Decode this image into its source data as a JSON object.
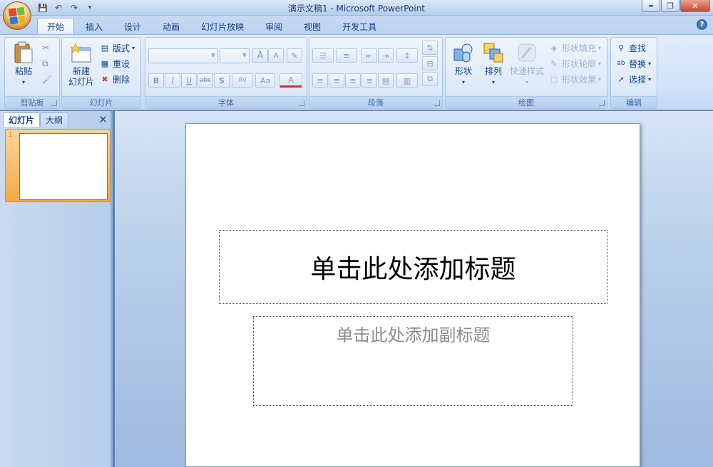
{
  "window": {
    "title": "演示文稿1 - Microsoft PowerPoint",
    "controls": {
      "minimize": "▬",
      "restore": "❐",
      "close": "✕"
    }
  },
  "quick_access": {
    "save": "💾",
    "undo": "↶",
    "redo": "↷",
    "customize": "▾"
  },
  "tabs": [
    {
      "label": "开始",
      "active": true
    },
    {
      "label": "插入"
    },
    {
      "label": "设计"
    },
    {
      "label": "动画"
    },
    {
      "label": "幻灯片放映"
    },
    {
      "label": "审阅"
    },
    {
      "label": "视图"
    },
    {
      "label": "开发工具"
    }
  ],
  "help": "?",
  "ribbon": {
    "clipboard": {
      "label": "剪贴板",
      "paste": "粘贴",
      "cut": "✂",
      "copy": "⧉",
      "format_painter": "🖌"
    },
    "slides": {
      "label": "幻灯片",
      "new_slide_line1": "新建",
      "new_slide_line2": "幻灯片",
      "layout": "版式",
      "reset": "重设",
      "delete": "删除"
    },
    "font": {
      "label": "字体",
      "bold": "B",
      "italic": "I",
      "underline": "U",
      "strike": "abc",
      "shadow": "S",
      "spacing": "AV",
      "case": "Aa",
      "color": "A",
      "grow": "A",
      "shrink": "A"
    },
    "paragraph": {
      "label": "段落"
    },
    "drawing": {
      "label": "绘图",
      "shapes": "形状",
      "arrange": "排列",
      "quick_styles": "快速样式",
      "shape_fill": "形状填充",
      "shape_outline": "形状轮廓",
      "shape_effects": "形状效果"
    },
    "editing": {
      "label": "编辑",
      "find": "查找",
      "replace": "替换",
      "select": "选择"
    }
  },
  "pane": {
    "tab_slides": "幻灯片",
    "tab_outline": "大纲",
    "close": "✕",
    "thumb_number": "1"
  },
  "slide": {
    "title_placeholder": "单击此处添加标题",
    "subtitle_placeholder": "单击此处添加副标题"
  },
  "colors": {
    "accent": "#15428b",
    "ribbon": "#dce9f9",
    "thumb_selected": "#f4a845"
  }
}
